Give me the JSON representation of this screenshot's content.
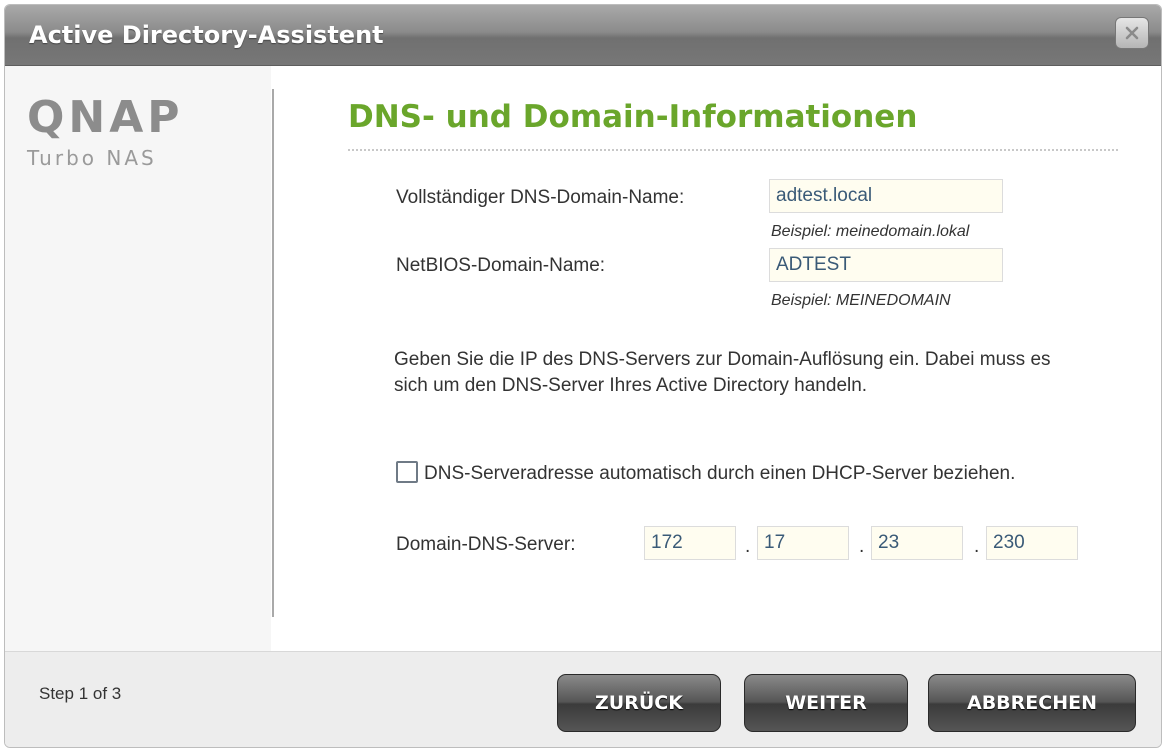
{
  "window": {
    "title": "Active Directory-Assistent",
    "close_icon": "close-icon"
  },
  "brand": {
    "logo": "QNAP",
    "tagline": "Turbo NAS"
  },
  "page": {
    "heading": "DNS- und Domain-Informationen"
  },
  "form": {
    "dns_domain": {
      "label": "Vollständiger DNS-Domain-Name:",
      "value": "adtest.local",
      "example": "Beispiel: meinedomain.lokal"
    },
    "netbios_domain": {
      "label": "NetBIOS-Domain-Name:",
      "value": "ADTEST",
      "example": "Beispiel: MEINEDOMAIN"
    },
    "info_text": "Geben Sie die IP des DNS-Servers zur Domain-Auflösung ein. Dabei muss es sich um den DNS-Server Ihres Active Directory handeln.",
    "dhcp_checkbox": {
      "label": "DNS-Serveradresse automatisch durch einen DHCP-Server beziehen.",
      "checked": false
    },
    "dns_server": {
      "label": "Domain-DNS-Server:",
      "octets": [
        "172",
        "17",
        "23",
        "230"
      ],
      "separator": "."
    }
  },
  "footer": {
    "step": "Step 1 of 3",
    "back_label": "ZURÜCK",
    "next_label": "WEITER",
    "cancel_label": "ABBRECHEN"
  },
  "colors": {
    "heading": "#6aa62b",
    "titlebar": "#8b8b8b",
    "button": "#4a4a4a",
    "field_bg": "#fffdf0"
  }
}
